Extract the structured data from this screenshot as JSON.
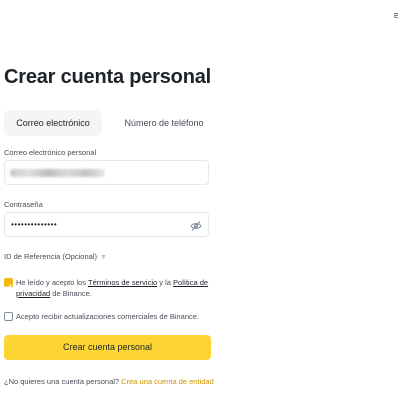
{
  "corner_text": "E",
  "title": "Crear cuenta personal",
  "tabs": [
    {
      "label": "Correo electrónico",
      "active": true
    },
    {
      "label": "Número de teléfono",
      "active": false
    }
  ],
  "email": {
    "label": "Correo electrónico personal",
    "value": ""
  },
  "password": {
    "label": "Contraseña",
    "value": "••••••••••••••"
  },
  "referral": {
    "label": "ID de Referencia (Opcional)",
    "caret": "▼"
  },
  "terms": {
    "checked": true,
    "text_1": "He leído y acepto los ",
    "link_1": "Términos de servicio",
    "text_2": " y la ",
    "link_2": "Política de privacidad",
    "text_3": " de Binance."
  },
  "marketing": {
    "checked": false,
    "text": "Acepto recibir actualizaciones comerciales de Binance."
  },
  "submit_label": "Crear cuenta personal",
  "footer": {
    "question": "¿No quieres una cuenta personal? ",
    "link": "Crea una cuenta de entidad"
  },
  "colors": {
    "accent": "#fcd535",
    "checkbox": "#f0b90b",
    "link_yellow": "#c99400"
  }
}
